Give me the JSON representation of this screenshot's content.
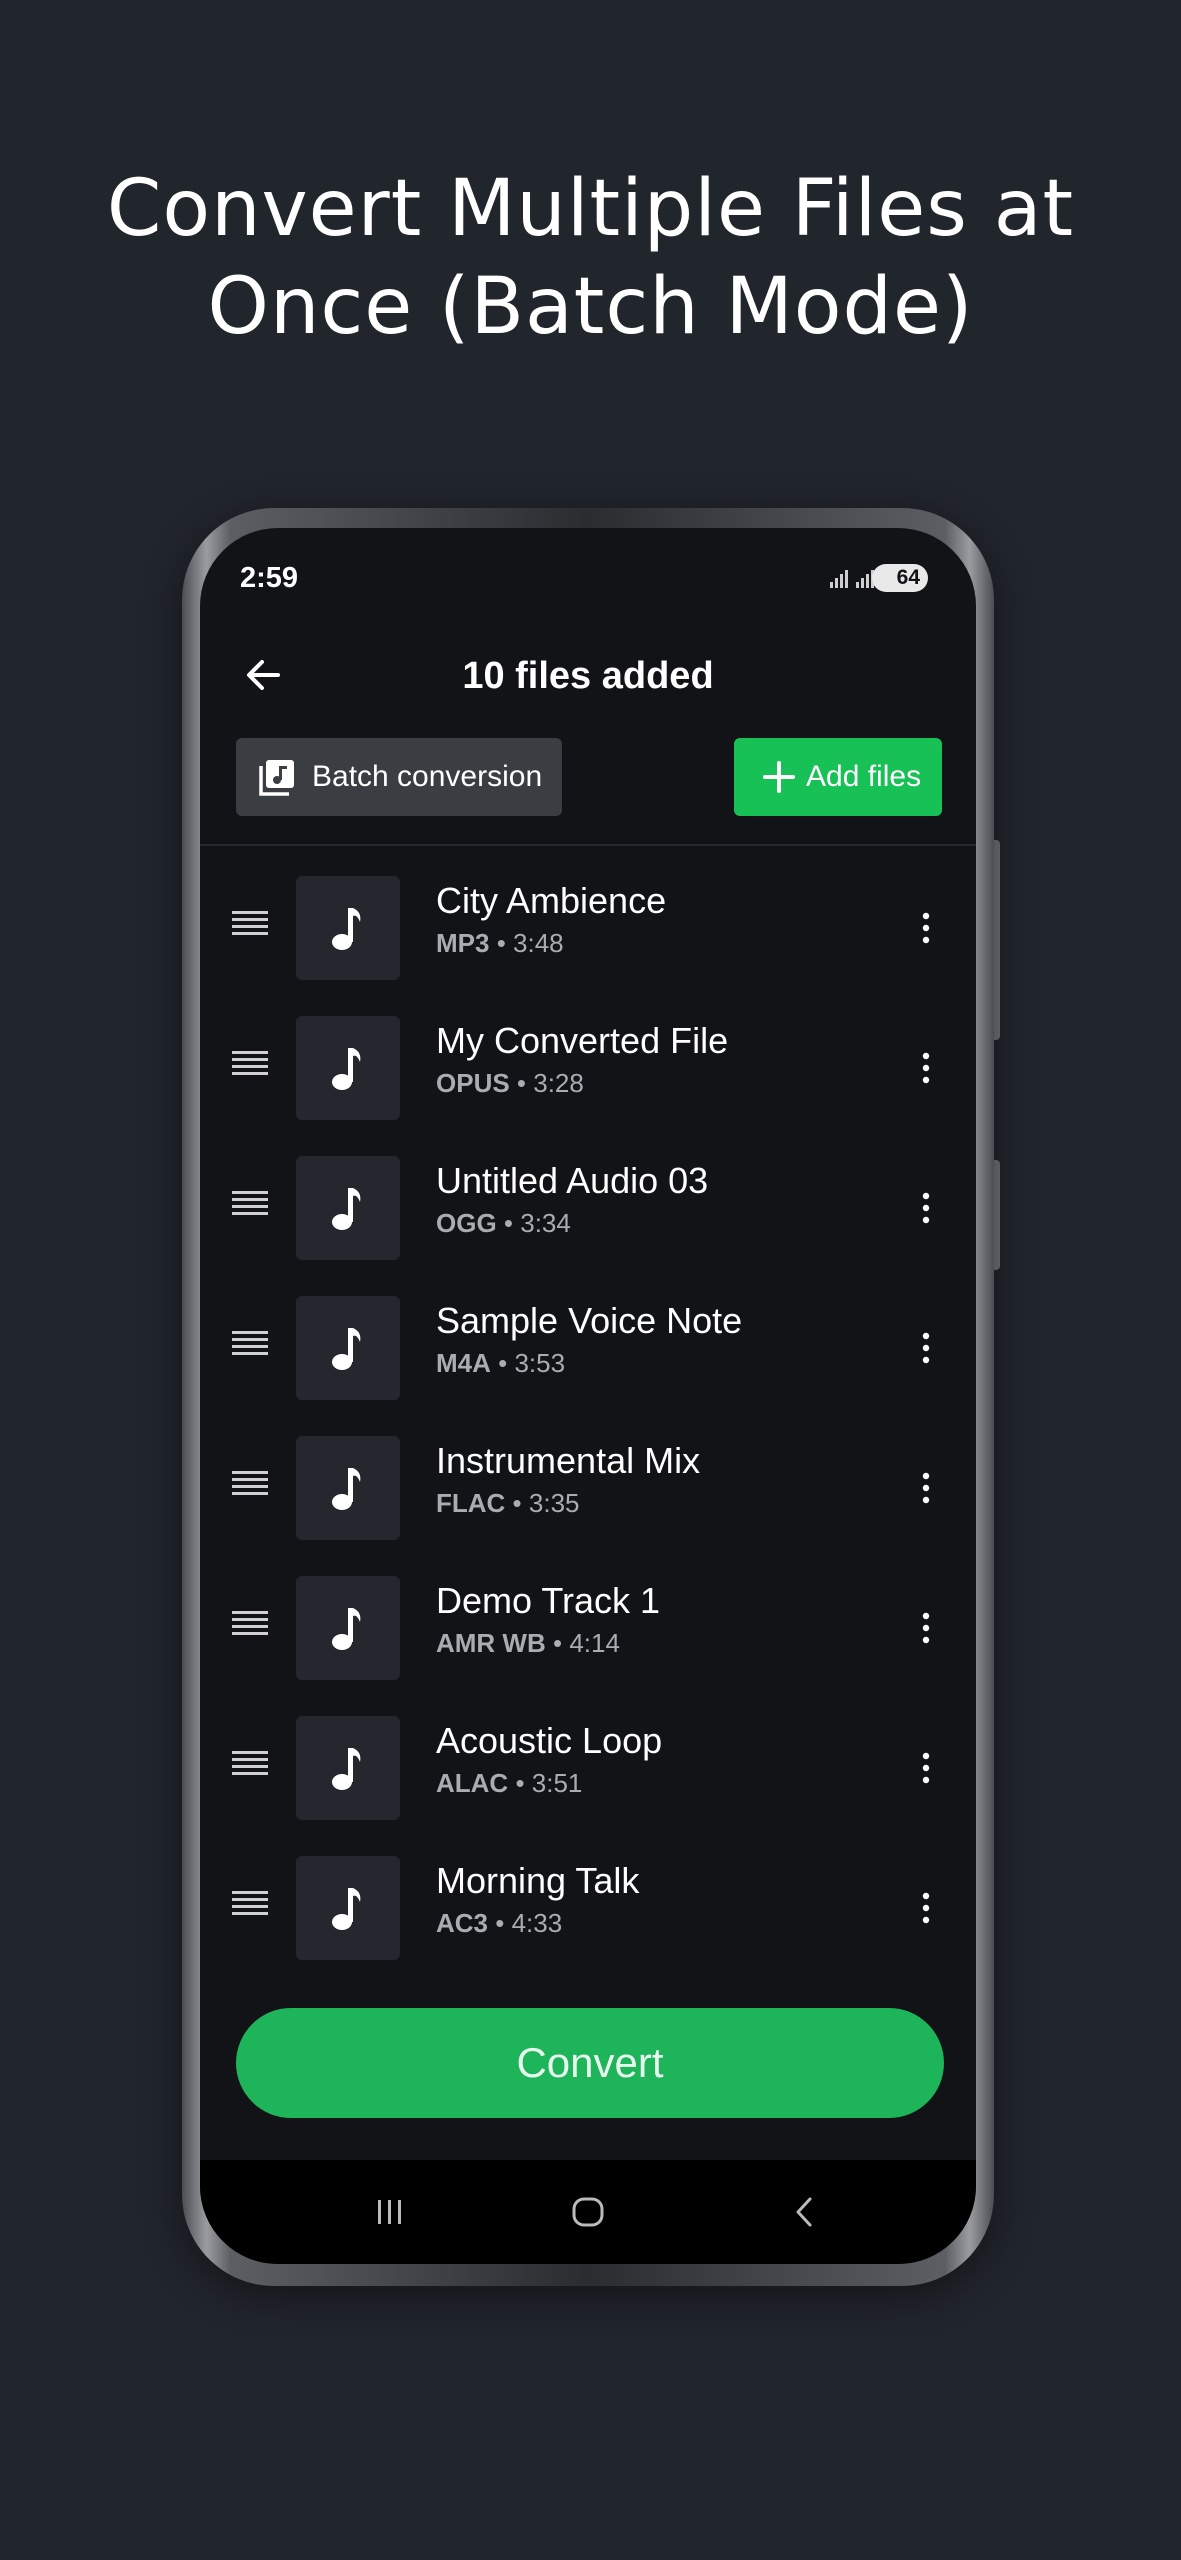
{
  "headline": "Convert Multiple Files at Once (Batch Mode)",
  "status_bar": {
    "time": "2:59",
    "battery": "64"
  },
  "app_bar": {
    "title": "10 files added"
  },
  "toolbar": {
    "batch_label": "Batch conversion",
    "add_label": "Add files"
  },
  "files": [
    {
      "name": "City Ambience",
      "format": "MP3",
      "duration": "3:48"
    },
    {
      "name": "My Converted File",
      "format": "OPUS",
      "duration": "3:28"
    },
    {
      "name": "Untitled Audio 03",
      "format": "OGG",
      "duration": "3:34"
    },
    {
      "name": "Sample Voice Note",
      "format": "M4A",
      "duration": "3:53"
    },
    {
      "name": "Instrumental Mix",
      "format": "FLAC",
      "duration": "3:35"
    },
    {
      "name": "Demo Track 1",
      "format": "AMR WB",
      "duration": "4:14"
    },
    {
      "name": "Acoustic Loop",
      "format": "ALAC",
      "duration": "3:51"
    },
    {
      "name": "Morning Talk",
      "format": "AC3",
      "duration": "4:33"
    }
  ],
  "meta_separator": " • ",
  "convert_label": "Convert",
  "colors": {
    "background": "#21252c",
    "screen": "#111316",
    "accent": "#18c155",
    "convert": "#1db45a",
    "batch_button": "#3a3d42"
  },
  "icons": {
    "back": "arrow-left-icon",
    "batch": "music-library-icon",
    "add": "plus-icon",
    "drag": "drag-handle-icon",
    "thumb": "music-note-icon",
    "more": "more-vertical-icon",
    "nav_recents": "recents-icon",
    "nav_home": "home-icon",
    "nav_back": "nav-back-icon"
  }
}
